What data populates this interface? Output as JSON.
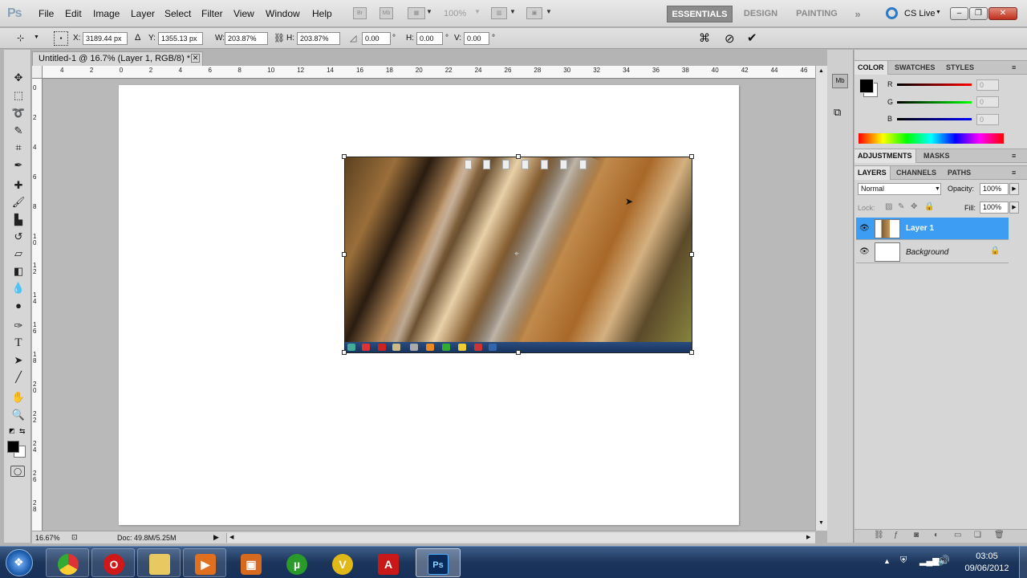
{
  "app": {
    "logo": "Ps"
  },
  "menu": [
    "File",
    "Edit",
    "Image",
    "Layer",
    "Select",
    "Filter",
    "View",
    "Window",
    "Help"
  ],
  "menubar": {
    "icon_br": "Br",
    "icon_mb": "Mb",
    "zoom": "100%",
    "workspaces": [
      "ESSENTIALS",
      "DESIGN",
      "PAINTING"
    ],
    "more": "»",
    "cslive": "CS Live"
  },
  "options": {
    "x_label": "X:",
    "x_value": "3189.44 px",
    "y_label": "Y:",
    "y_value": "1355.13 px",
    "w_label": "W:",
    "w_value": "203.87%",
    "h_label": "H:",
    "h_value": "203.87%",
    "angle_value": "0.00",
    "angle_unit": "°",
    "hskew_label": "H:",
    "hskew_value": "0.00",
    "hskew_unit": "°",
    "vskew_label": "V:",
    "vskew_value": "0.00",
    "vskew_unit": "°"
  },
  "document": {
    "tab_title": "Untitled-1 @ 16.7% (Layer 1, RGB/8) *"
  },
  "ruler": {
    "h_labels": [
      "4",
      "2",
      "0",
      "2",
      "4",
      "6",
      "8",
      "10",
      "12",
      "14",
      "16",
      "18",
      "20",
      "22",
      "24",
      "26",
      "28",
      "30",
      "32",
      "34",
      "36",
      "38",
      "40",
      "42",
      "44",
      "46",
      "48"
    ],
    "v_labels": [
      "0",
      "2",
      "4",
      "6",
      "8",
      "1\n0",
      "1\n2",
      "1\n4",
      "1\n6",
      "1\n8",
      "2\n0",
      "2\n2",
      "2\n4",
      "2\n6",
      "2\n8"
    ]
  },
  "status": {
    "zoom": "16.67%",
    "doc_size": "Doc: 49.8M/5.25M"
  },
  "color_panel": {
    "tabs": [
      "COLOR",
      "SWATCHES",
      "STYLES"
    ],
    "r_label": "R",
    "g_label": "G",
    "b_label": "B",
    "r_value": "0",
    "g_value": "0",
    "b_value": "0"
  },
  "adjust_panel": {
    "tabs": [
      "ADJUSTMENTS",
      "MASKS"
    ]
  },
  "layers_panel": {
    "tabs": [
      "LAYERS",
      "CHANNELS",
      "PATHS"
    ],
    "blend_mode": "Normal",
    "opacity_label": "Opacity:",
    "opacity_value": "100%",
    "lock_label": "Lock:",
    "fill_label": "Fill:",
    "fill_value": "100%",
    "layers": [
      {
        "name": "Layer 1",
        "selected": true
      },
      {
        "name": "Background",
        "selected": false
      }
    ]
  },
  "taskbar": {
    "time": "03:05",
    "date": "09/06/2012"
  },
  "colors": {
    "accent_selected_layer": "#3d9df2",
    "essentials_bg": "#8b8b8b",
    "taskbar": "#1c355a"
  }
}
